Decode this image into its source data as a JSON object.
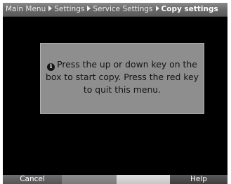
{
  "breadcrumb": {
    "items": [
      "Main Menu",
      "Settings",
      "Service Settings"
    ],
    "current": "Copy settings",
    "separator_icon": "triangle-right-icon"
  },
  "dialog": {
    "icon": "info-icon",
    "icon_glyph": "i",
    "message": "Press the up or down key on the box to start copy. Press the red key to quit this menu."
  },
  "footer": {
    "buttons": [
      {
        "label": "Cancel",
        "color": "#6a6a6a"
      },
      {
        "label": "",
        "color": "#8a8a8a"
      },
      {
        "label": "",
        "color": "#d6d6d6"
      },
      {
        "label": "Help",
        "color": "#4a4a4a"
      }
    ]
  }
}
